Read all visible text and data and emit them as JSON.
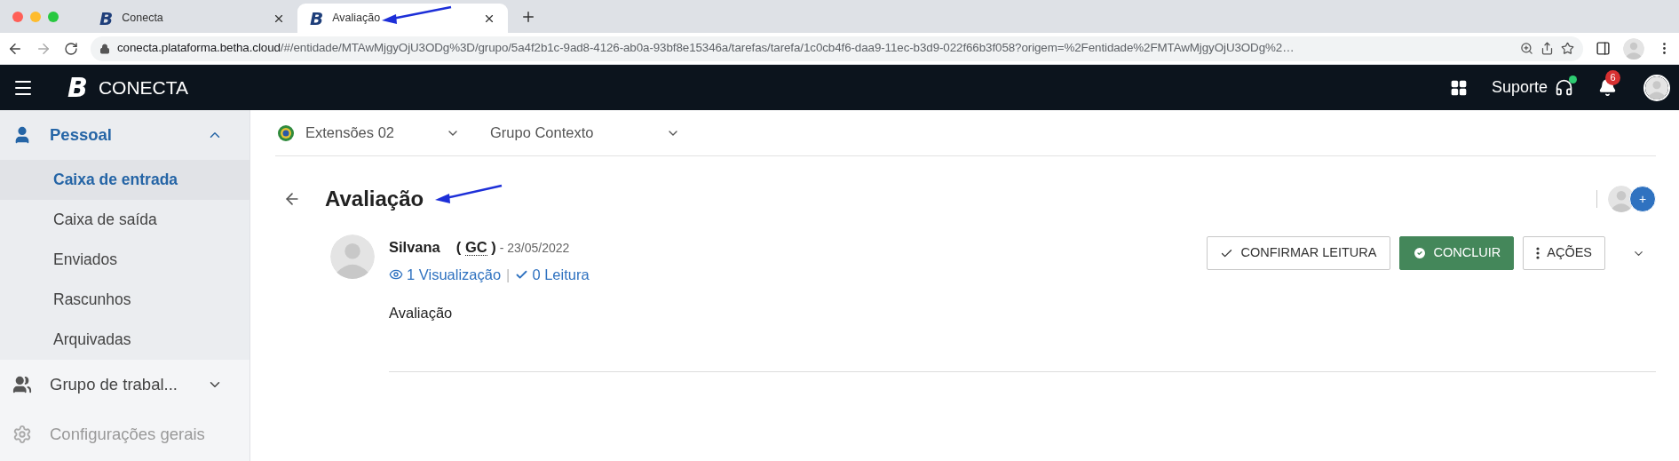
{
  "browser": {
    "tabs": [
      {
        "favicon_mark": "B",
        "title": "Conecta",
        "selected": false
      },
      {
        "favicon_mark": "B",
        "title": "Avaliação",
        "selected": true
      }
    ],
    "url_host": "conecta.plataforma.betha.cloud",
    "url_path": "/#/entidade/MTAwMjgyOjU3ODg%3D/grupo/5a4f2b1c-9ad8-4126-ab0a-93bf8e15346a/tarefas/tarefa/1c0cb4f6-daa9-11ec-b3d9-022f66b3f058?origem=%2Fentidade%2FMTAwMjgyOjU3ODg%2…"
  },
  "header": {
    "brand_mark": "B",
    "brand": "CONECTA",
    "support": "Suporte",
    "support_online": true,
    "notifications": "6"
  },
  "sidebar": {
    "items": [
      {
        "label": "Pessoal",
        "kind": "person",
        "expanded": true,
        "disabled": false,
        "children": [
          {
            "label": "Caixa de entrada",
            "selected": true
          },
          {
            "label": "Caixa de saída",
            "selected": false
          },
          {
            "label": "Enviados",
            "selected": false
          },
          {
            "label": "Rascunhos",
            "selected": false
          },
          {
            "label": "Arquivadas",
            "selected": false
          }
        ]
      },
      {
        "label": "Grupo de trabal...",
        "kind": "group",
        "expanded": false,
        "disabled": false
      },
      {
        "label": "Configurações gerais",
        "kind": "settings",
        "disabled": true
      }
    ]
  },
  "context": {
    "entity": "Extensões 02",
    "group": "Grupo Contexto"
  },
  "page": {
    "title": "Avaliação",
    "add_participant": "+"
  },
  "message": {
    "author": "Silvana",
    "initials_open": "(",
    "initials": "GC",
    "initials_close": ")",
    "date": "- 23/05/2022",
    "views": "1 Visualização",
    "separator": "|",
    "reads": "0 Leitura",
    "body": "Avaliação",
    "actions": [
      {
        "label": "CONFIRMAR LEITURA",
        "kind": "confirm"
      },
      {
        "label": "CONCLUIR",
        "kind": "primary"
      },
      {
        "label": "AÇÕES",
        "kind": "menu"
      }
    ]
  }
}
